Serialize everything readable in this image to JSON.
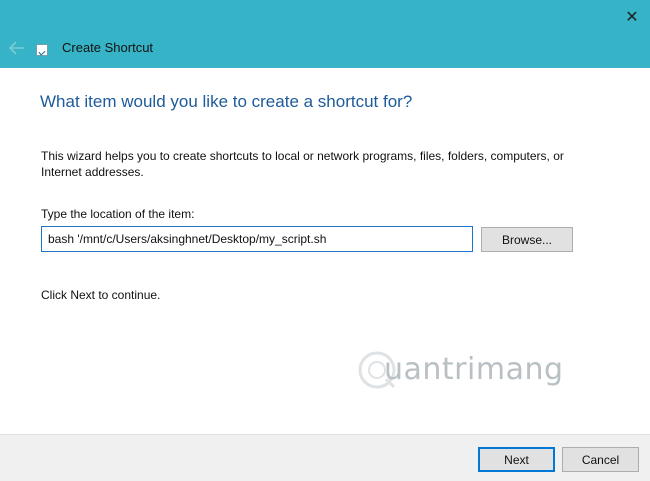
{
  "window": {
    "title": "Create Shortcut",
    "close_glyph": "✕",
    "back_icon": "back-arrow-icon",
    "title_icon": "shortcut-icon",
    "accent_color": "#36b3c6"
  },
  "main": {
    "heading": "What item would you like to create a shortcut for?",
    "description": "This wizard helps you to create shortcuts to local or network programs, files, folders, computers, or Internet addresses.",
    "location_label": "Type the location of the item:",
    "location_value": "bash '/mnt/c/Users/aksinghnet/Desktop/my_script.sh",
    "browse_label": "Browse...",
    "continue_text": "Click Next to continue."
  },
  "footer": {
    "next_label": "Next",
    "cancel_label": "Cancel"
  },
  "watermark": {
    "text": "uantrimang"
  }
}
